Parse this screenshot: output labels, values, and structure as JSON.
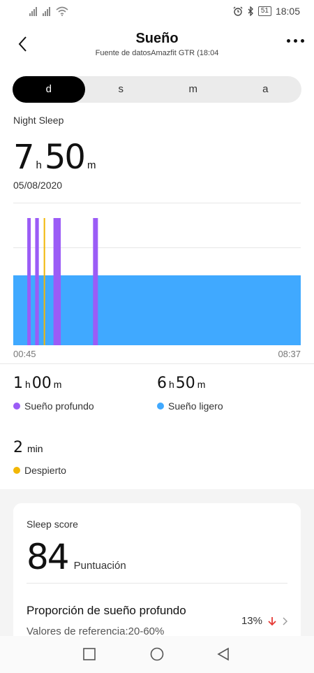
{
  "status": {
    "time": "18:05",
    "battery": "51"
  },
  "header": {
    "title": "Sueño",
    "subtitle": "Fuente de datosAmazfit GTR (18:04"
  },
  "tabs": [
    {
      "label": "d",
      "active": true
    },
    {
      "label": "s",
      "active": false
    },
    {
      "label": "m",
      "active": false
    },
    {
      "label": "a",
      "active": false
    }
  ],
  "night": {
    "label": "Night Sleep",
    "hours": "7",
    "hours_unit": "h",
    "minutes": "50",
    "minutes_unit": "m",
    "date": "05/08/2020"
  },
  "chart_data": {
    "type": "timeline",
    "x_start": "00:45",
    "x_end": "08:37",
    "colors": {
      "deep": "#9B5CF6",
      "light": "#40A9FF",
      "awake": "#F2B705"
    },
    "segments": [
      {
        "stage": "light",
        "from": "00:45",
        "to": "08:37"
      },
      {
        "stage": "deep",
        "from": "01:08",
        "to": "01:11"
      },
      {
        "stage": "deep",
        "from": "01:21",
        "to": "01:27"
      },
      {
        "stage": "awake",
        "from": "01:35",
        "to": "01:36"
      },
      {
        "stage": "deep",
        "from": "01:51",
        "to": "02:03"
      },
      {
        "stage": "deep",
        "from": "02:56",
        "to": "03:04"
      }
    ]
  },
  "stats": {
    "deep": {
      "h": "1",
      "h_unit": "h",
      "m": "00",
      "m_unit": "m",
      "label": "Sueño profundo"
    },
    "light": {
      "h": "6",
      "h_unit": "h",
      "m": "50",
      "m_unit": "m",
      "label": "Sueño ligero"
    },
    "awake": {
      "m": "2",
      "m_unit": "min",
      "label": "Despierto"
    }
  },
  "score": {
    "label": "Sleep score",
    "value": "84",
    "unit": "Puntuación",
    "deep_ratio_title": "Proporción de sueño profundo",
    "deep_ratio_ref": "Valores de referencia:20-60%",
    "deep_ratio_value": "13%"
  }
}
